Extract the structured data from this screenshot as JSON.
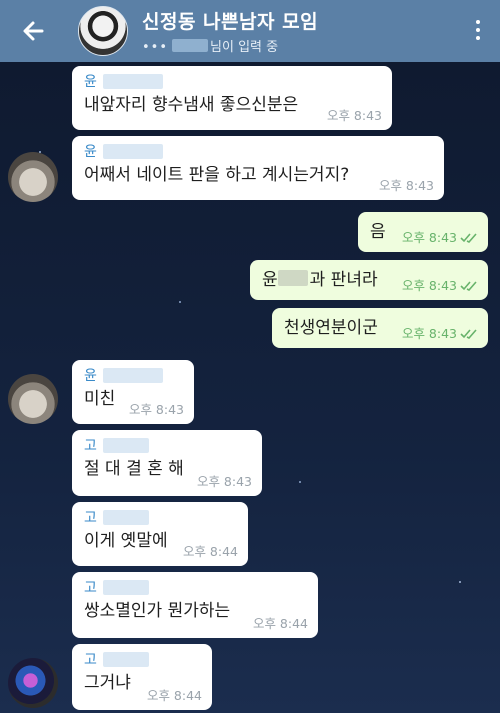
{
  "header": {
    "title": "신정동 나쁜남자 모임",
    "typing_dots": "•••",
    "typing_text": "님이 입력 중"
  },
  "messages": [
    {
      "side": "in",
      "sender": "윤",
      "text": "내앞자리 향수냄새 좋으신분은",
      "time": "오후 8:43"
    },
    {
      "side": "in",
      "sender": "윤",
      "text": "어째서 네이트 판을 하고 계시는거지?",
      "time": "오후 8:43"
    },
    {
      "side": "out",
      "text": "음",
      "time": "오후 8:43"
    },
    {
      "side": "out",
      "text": "과 판녀라",
      "time": "오후 8:43",
      "prefix": "윤"
    },
    {
      "side": "out",
      "text": "천생연분이군",
      "time": "오후 8:43"
    },
    {
      "side": "in",
      "sender": "윤",
      "text": "미친",
      "time": "오후 8:43"
    },
    {
      "side": "in",
      "sender": "고",
      "text": "절 대 결 혼 해",
      "time": "오후 8:43"
    },
    {
      "side": "in",
      "sender": "고",
      "text": "이게 옛말에",
      "time": "오후 8:44"
    },
    {
      "side": "in",
      "sender": "고",
      "text": "쌍소멸인가 뭔가하는",
      "time": "오후 8:44"
    },
    {
      "side": "in",
      "sender": "고",
      "text": "그거냐",
      "time": "오후 8:44"
    }
  ],
  "colors": {
    "header": "#5b80a6",
    "incoming": "#ffffff",
    "outgoing": "#effdde",
    "sender": "#3a8ac8",
    "outgoing_time": "#68b36b"
  }
}
